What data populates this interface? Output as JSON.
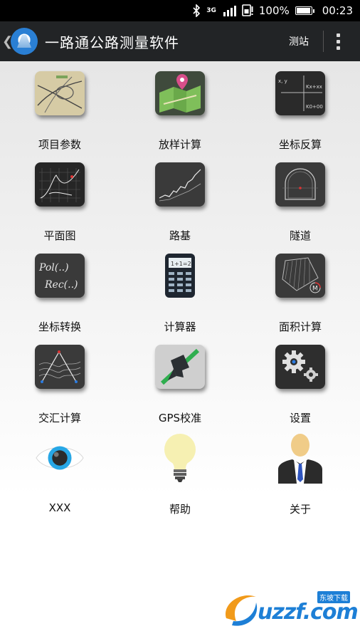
{
  "status_bar": {
    "network": "3G",
    "signal_label": "36.11 1K.ıl",
    "battery": "100%",
    "battery_level": 1.0,
    "time": "00:23"
  },
  "action_bar": {
    "back": "❮",
    "title": "一路通公路测量软件",
    "action": "测站"
  },
  "menu": [
    {
      "label": "项目参数",
      "icon": "interchange-map-icon"
    },
    {
      "label": "放样计算",
      "icon": "map-pin-icon"
    },
    {
      "label": "坐标反算",
      "icon": "coordinate-formula-icon",
      "text_a": "x, y",
      "text_b": "Kx+xx",
      "text_c": "K0+00"
    },
    {
      "label": "平面图",
      "icon": "plan-view-icon"
    },
    {
      "label": "路基",
      "icon": "subgrade-profile-icon"
    },
    {
      "label": "隧道",
      "icon": "tunnel-section-icon"
    },
    {
      "label": "坐标转换",
      "icon": "pol-rec-icon",
      "text_a": "Pol(..)",
      "text_b": "Rec(..)"
    },
    {
      "label": "计算器",
      "icon": "calculator-icon",
      "text_a": "1+1=2"
    },
    {
      "label": "面积计算",
      "icon": "area-calc-icon",
      "text_a": "M"
    },
    {
      "label": "交汇计算",
      "icon": "intersection-calc-icon"
    },
    {
      "label": "GPS校准",
      "icon": "gps-satellite-icon"
    },
    {
      "label": "设置",
      "icon": "gears-icon"
    },
    {
      "label": "XXX",
      "icon": "eye-icon"
    },
    {
      "label": "帮助",
      "icon": "lightbulb-icon"
    },
    {
      "label": "关于",
      "icon": "person-icon"
    }
  ],
  "watermark": {
    "text": "uzzf.com",
    "tag": "东坡下载"
  },
  "colors": {
    "action_bar": "#222426",
    "status_bar": "#000000",
    "tile_dark": "#2e2e2e",
    "watermark_blue": "#1d7fd6"
  }
}
